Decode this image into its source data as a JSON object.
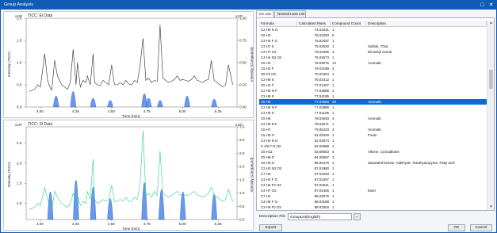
{
  "window": {
    "title": "Group Analysis"
  },
  "charts": [
    {
      "title": "TICC: EI Data",
      "y_left_label": "Intensity (TICC)",
      "y_right_label": "Intensity (Compound)",
      "x_label": "Time [min]",
      "y_exp": "x10⁶",
      "right_exp": "x10⁶",
      "y_ticks": [
        "0.0",
        "0.5",
        "1.0",
        "1.5",
        "2.0"
      ],
      "right_ticks": [
        "0.00",
        "0.25",
        "0.50",
        "0.75",
        "1.00"
      ],
      "x_ticks": [
        "4.00",
        "4.25",
        "4.50",
        "4.75",
        "5.00",
        "5.25"
      ],
      "trace_color": "#2b2b2b",
      "fill_color": "#4f86e8"
    },
    {
      "title": "TICC: SI Data",
      "y_left_label": "Intensity (TICC)",
      "y_right_label": "Intensity (Compound)",
      "x_label": "Time [min]",
      "y_exp": "x10⁵",
      "right_exp": "x10⁵",
      "y_ticks": [
        "1.0",
        "1.5",
        "2.0",
        "2.5"
      ],
      "right_ticks": [
        "0.0",
        "0.5",
        "1.0",
        "1.5",
        "2.0",
        "2.5",
        "3.0",
        "3.5"
      ],
      "x_ticks": [
        "4.00",
        "4.25",
        "4.50",
        "4.75",
        "5.00",
        "5.25"
      ],
      "trace_color": "#2fcf8f",
      "fill_color": "#4f86e8"
    }
  ],
  "chart_data": [
    {
      "type": "line",
      "title": "TICC: EI Data",
      "xlabel": "Time [min]",
      "ylabel": "Intensity (TICC)",
      "y2label": "Intensity (Compound)",
      "xlim": [
        3.9,
        5.38
      ],
      "ylim": [
        0,
        2.0
      ],
      "y_scale_label": "x10⁶",
      "x": [
        3.92,
        3.96,
        3.98,
        4.0,
        4.03,
        4.05,
        4.07,
        4.08,
        4.1,
        4.12,
        4.15,
        4.17,
        4.19,
        4.21,
        4.23,
        4.25,
        4.26,
        4.28,
        4.3,
        4.32,
        4.33,
        4.35,
        4.37,
        4.38,
        4.4,
        4.42,
        4.44,
        4.46,
        4.48,
        4.5,
        4.52,
        4.54,
        4.56,
        4.58,
        4.6,
        4.62,
        4.64,
        4.66,
        4.68,
        4.7,
        4.72,
        4.74,
        4.76,
        4.78,
        4.8,
        4.82,
        4.84,
        4.86,
        4.88,
        4.9,
        4.92,
        4.94,
        4.96,
        4.98,
        5.0,
        5.02,
        5.04,
        5.06,
        5.08,
        5.1,
        5.12,
        5.14,
        5.16,
        5.18,
        5.2,
        5.22,
        5.24,
        5.26,
        5.28,
        5.3,
        5.32,
        5.35
      ],
      "series": [
        {
          "values": [
            0.35,
            0.4,
            0.5,
            0.45,
            1.2,
            0.6,
            0.42,
            0.38,
            1.05,
            0.7,
            0.5,
            0.45,
            0.4,
            0.55,
            1.3,
            0.5,
            1.0,
            0.45,
            0.6,
            0.55,
            0.7,
            0.5,
            1.2,
            0.55,
            0.5,
            0.48,
            0.6,
            0.55,
            0.5,
            0.95,
            0.5,
            0.5,
            0.55,
            0.5,
            0.6,
            0.52,
            0.5,
            0.6,
            0.55,
            0.95,
            1.55,
            0.6,
            0.65,
            0.55,
            0.6,
            0.58,
            1.85,
            0.65,
            0.6,
            0.55,
            0.58,
            0.62,
            0.7,
            0.6,
            0.62,
            0.6,
            0.58,
            0.62,
            0.7,
            0.6,
            0.58,
            0.55,
            0.6,
            0.62,
            1.05,
            0.6,
            0.55,
            0.5,
            0.45,
            0.5,
            0.95,
            0.5
          ]
        }
      ],
      "peaks_compound": [
        [
          4.11,
          0.25
        ],
        [
          4.23,
          0.35
        ],
        [
          4.37,
          0.2
        ],
        [
          4.49,
          0.15
        ],
        [
          4.73,
          0.3
        ],
        [
          4.76,
          0.2
        ],
        [
          4.84,
          0.15
        ],
        [
          5.03,
          0.25
        ],
        [
          5.22,
          0.18
        ]
      ]
    },
    {
      "type": "line",
      "title": "TICC: SI Data",
      "xlabel": "Time [min]",
      "ylabel": "Intensity (TICC)",
      "y2label": "Intensity (Compound)",
      "xlim": [
        3.9,
        5.38
      ],
      "ylim": [
        0.6,
        2.9
      ],
      "y_scale_label": "x10⁵",
      "x": [
        3.92,
        3.96,
        3.98,
        4.0,
        4.03,
        4.05,
        4.07,
        4.08,
        4.1,
        4.12,
        4.15,
        4.17,
        4.19,
        4.21,
        4.23,
        4.25,
        4.26,
        4.28,
        4.3,
        4.32,
        4.33,
        4.35,
        4.37,
        4.38,
        4.4,
        4.42,
        4.44,
        4.46,
        4.48,
        4.5,
        4.52,
        4.54,
        4.56,
        4.58,
        4.6,
        4.62,
        4.64,
        4.66,
        4.68,
        4.7,
        4.72,
        4.74,
        4.76,
        4.78,
        4.8,
        4.82,
        4.84,
        4.86,
        4.88,
        4.9,
        4.92,
        4.94,
        4.96,
        4.98,
        5.0,
        5.02,
        5.04,
        5.06,
        5.08,
        5.1,
        5.12,
        5.14,
        5.16,
        5.18,
        5.2,
        5.22,
        5.24,
        5.26,
        5.28,
        5.3,
        5.32,
        5.35
      ],
      "series": [
        {
          "values": [
            0.85,
            0.9,
            1.0,
            0.95,
            1.4,
            1.1,
            0.9,
            0.85,
            1.3,
            1.15,
            1.0,
            0.95,
            0.9,
            1.0,
            1.25,
            1.05,
            1.2,
            0.95,
            1.05,
            1.0,
            1.3,
            1.1,
            2.1,
            1.1,
            1.0,
            1.05,
            1.1,
            1.05,
            1.1,
            1.45,
            1.05,
            1.05,
            1.1,
            1.05,
            1.15,
            1.05,
            1.05,
            1.15,
            1.1,
            1.5,
            2.8,
            1.2,
            1.25,
            1.15,
            1.3,
            1.2,
            2.3,
            1.25,
            1.2,
            1.15,
            1.2,
            1.25,
            1.3,
            1.2,
            1.25,
            1.2,
            1.2,
            1.25,
            1.3,
            1.2,
            1.2,
            1.15,
            1.2,
            1.25,
            1.4,
            1.2,
            1.15,
            1.1,
            1.05,
            1.1,
            1.35,
            1.05
          ]
        }
      ],
      "peaks_compound": [
        [
          4.07,
          0.6
        ],
        [
          4.25,
          0.85
        ],
        [
          4.37,
          0.7
        ],
        [
          4.49,
          0.45
        ],
        [
          4.73,
          0.8
        ],
        [
          4.85,
          0.65
        ],
        [
          5.0,
          0.6
        ],
        [
          5.22,
          0.55
        ]
      ]
    }
  ],
  "tabs": [
    {
      "label": "Ion List",
      "active": true
    },
    {
      "label": "Neutral Loss List",
      "active": false
    }
  ],
  "table": {
    "columns": [
      "Formula",
      "Calculated Mass",
      "Compound Count",
      "Description"
    ],
    "selected_index": 13,
    "rows": [
      [
        "C2 H5 N O",
        "74.01641",
        "1",
        ""
      ],
      [
        "C6 H3",
        "75.02293",
        "5",
        ""
      ],
      [
        "C3 H4 F O",
        "75.02407",
        "1",
        ""
      ],
      [
        "C3 H7 S",
        "75.02630",
        "1",
        "Sulfide, Thiol,"
      ],
      [
        "C3 H7 O2",
        "75.04406",
        "2",
        "Dimethyl acetal"
      ],
      [
        "C4 H4 N2 O2",
        "76.02673",
        "1",
        ""
      ],
      [
        "C6 H4",
        "76.03075",
        "14",
        "Aromatic"
      ],
      [
        "C5 H3 F",
        "76.03189",
        "2",
        ""
      ],
      [
        "H6 F2 O2",
        "76.03304",
        "1",
        ""
      ],
      [
        "C3 H8 S",
        "76.03412",
        "1",
        ""
      ],
      [
        "C5 H2 F",
        "77.01407",
        "1",
        ""
      ],
      [
        "C2 H6 N F",
        "77.03689",
        "1",
        ""
      ],
      [
        "C3 H9 S",
        "77.04195",
        "1",
        ""
      ],
      [
        "C6 H5",
        "77.03858",
        "29",
        "Aromatic"
      ],
      [
        "C2 H5 N F",
        "77.03889",
        "1",
        ""
      ],
      [
        "C3 H9 S",
        "77.04195",
        "1",
        ""
      ],
      [
        "C6 H6",
        "78.04640",
        "4",
        "Aromatic"
      ],
      [
        "C2 H9 N F",
        "78.04671",
        "1",
        ""
      ],
      [
        "C6 H7",
        "79.05423",
        "4",
        "Aromatic"
      ],
      [
        "C5 H5 O",
        "81.03349",
        "1",
        "Furan"
      ],
      [
        "C4 H4 N O",
        "82.02874",
        "1",
        ""
      ],
      [
        "C H5 F N O2",
        "82.02988",
        "1",
        ""
      ],
      [
        "C6 H11",
        "83.08553",
        "4",
        "Alkene, Cycloalkane"
      ],
      [
        "C5 H8 O",
        "84.05697",
        "2",
        ""
      ],
      [
        "C5 H9 O",
        "85.06478",
        "4",
        "Saturated ketone, Aldehyde, Tetrahydropyran, Fatty acid"
      ],
      [
        "C2 H3 N2 O2",
        "87.01890",
        "1",
        ""
      ],
      [
        "C7 H3",
        "87.02293",
        "1",
        ""
      ],
      [
        "C4 H4 F O",
        "87.02407",
        "1",
        ""
      ],
      [
        "C3 H5 F2 O2",
        "87.02521",
        "1",
        ""
      ],
      [
        "C4 H7 O2",
        "87.04406",
        "1",
        "Ester"
      ],
      [
        "C7 H4",
        "88.03075",
        "1",
        ""
      ],
      [
        "C4 H5 F O",
        "88.03189",
        "1",
        ""
      ],
      [
        "C3 H6 F2 O2",
        "88.03304",
        "1",
        ""
      ],
      [
        "C2 H7 F3",
        "88.04844",
        "1",
        ""
      ]
    ]
  },
  "description_file": {
    "label": "Description File",
    "value": "GroupList(English)",
    "browse_label": "..."
  },
  "buttons": {
    "export": "Export",
    "ok": "OK",
    "cancel": "Cancel"
  },
  "titlebar_icons": [
    "restore-icon",
    "close-icon"
  ]
}
